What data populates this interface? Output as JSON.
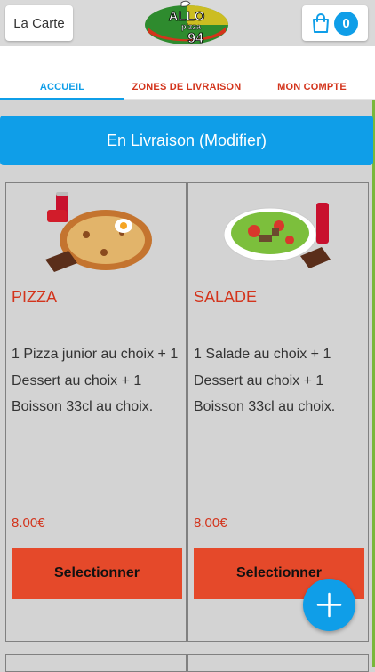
{
  "header": {
    "menu_label": "La Carte",
    "logo": {
      "line1": "ALLO",
      "line2": "pizza",
      "line3": "94"
    },
    "cart_count": "0"
  },
  "nav": {
    "tabs": [
      {
        "label": "ACCUEIL"
      },
      {
        "label": "ZONES DE LIVRAISON"
      },
      {
        "label": "MON COMPTE"
      }
    ]
  },
  "delivery": {
    "label": "En Livraison (Modifier)"
  },
  "products": [
    {
      "title": "PIZZA",
      "description": "1 Pizza junior au choix  + 1 Dessert au choix  + 1 Boisson 33cl au choix.",
      "price": "8.00€",
      "button_label": "Selectionner",
      "image": "pizza-menu-image"
    },
    {
      "title": "SALADE",
      "description": "1 Salade au choix  + 1 Dessert au choix  + 1 Boisson 33cl au choix.",
      "price": "8.00€",
      "button_label": "Selectionner",
      "image": "salad-menu-image"
    }
  ],
  "colors": {
    "accent_blue": "#0f9ee8",
    "brand_red": "#d3341c",
    "button_orange": "#e5492a",
    "background_gray": "#d3d3d3"
  },
  "fab": {
    "icon": "plus-icon"
  }
}
